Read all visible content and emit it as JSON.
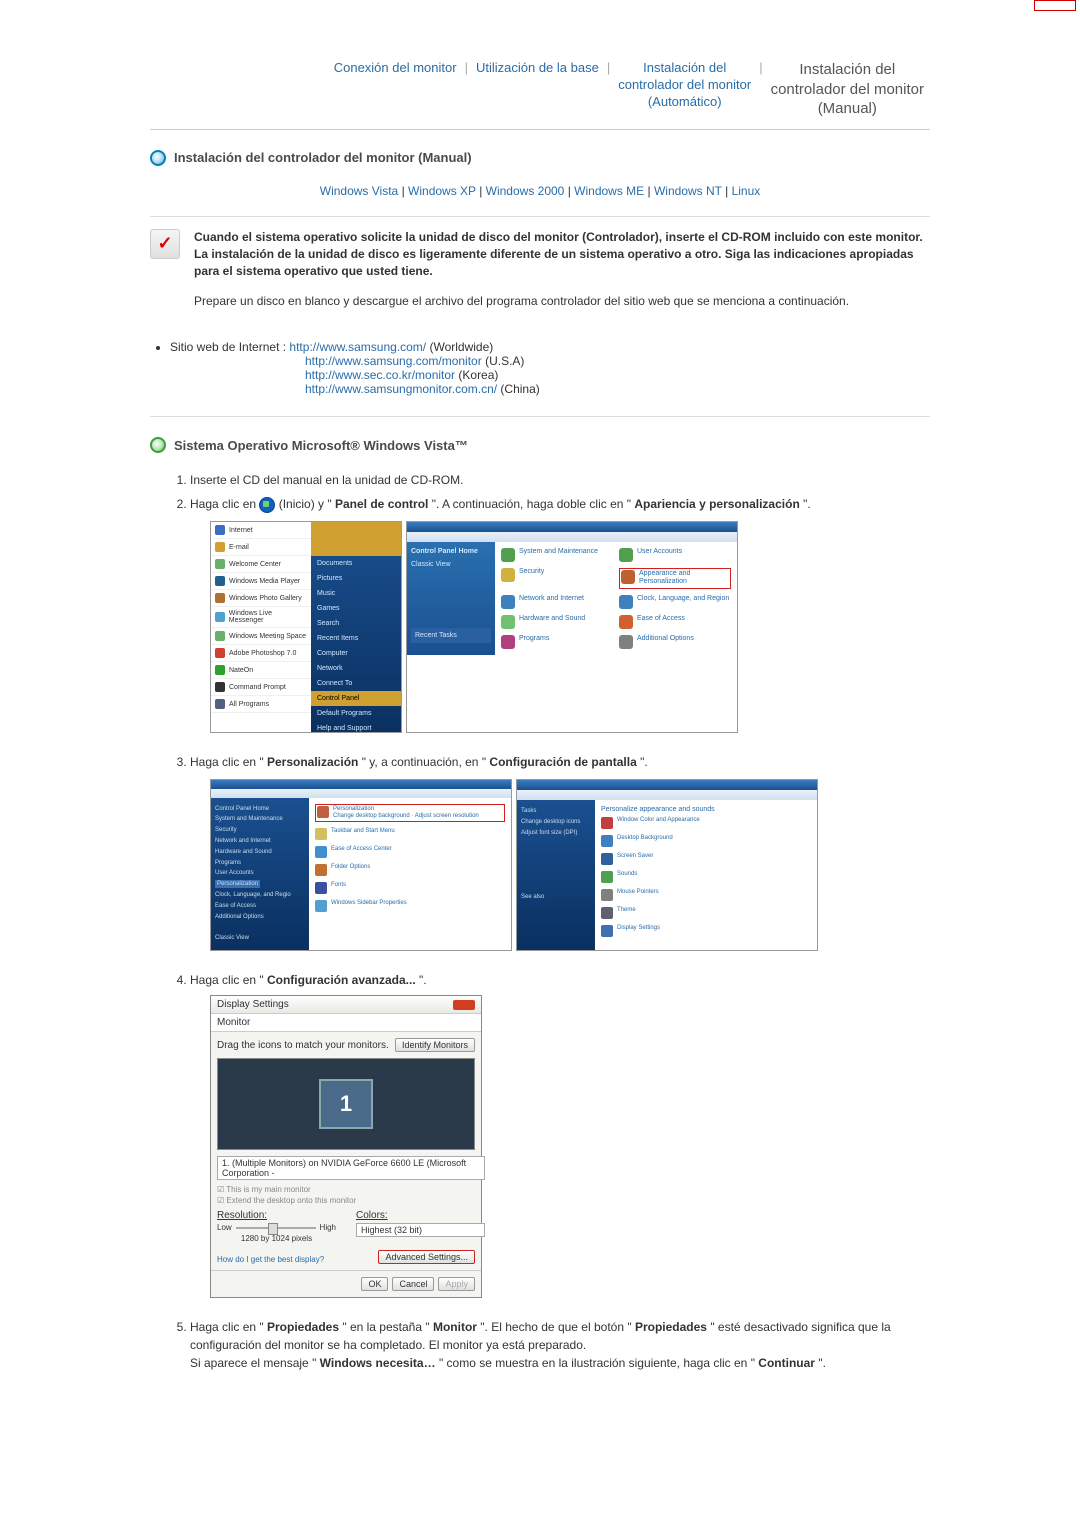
{
  "tabs": {
    "t1": "Conexión del monitor",
    "t2": "Utilización de la base",
    "t3": "Instalación del\ncontrolador del monitor\n(Automático)",
    "t4": "Instalación del\ncontrolador del monitor\n(Manual)"
  },
  "section1": {
    "title": "Instalación del controlador del monitor (Manual)"
  },
  "os_links": {
    "vista": "Windows Vista",
    "xp": "Windows XP",
    "w2000": "Windows 2000",
    "me": "Windows ME",
    "nt": "Windows NT",
    "linux": "Linux",
    "sep": " | "
  },
  "notice": {
    "text_bold": "Cuando el sistema operativo solicite la unidad de disco del monitor (Controlador), inserte el CD-ROM incluido con este monitor. La instalación de la unidad de disco es ligeramente diferente de un sistema operativo a otro. Siga las indicaciones apropiadas para el sistema operativo que usted tiene.",
    "para": "Prepare un disco en blanco y descargue el archivo del programa controlador del sitio web que se menciona a continuación."
  },
  "sites": {
    "lead": "Sitio web de Internet :",
    "url1": "http://www.samsung.com/",
    "suf1": " (Worldwide)",
    "url2": "http://www.samsung.com/monitor",
    "suf2": " (U.S.A)",
    "url3": "http://www.sec.co.kr/monitor",
    "suf3": " (Korea)",
    "url4": "http://www.samsungmonitor.com.cn/",
    "suf4": " (China)"
  },
  "section2": {
    "title": "Sistema Operativo Microsoft® Windows Vista™"
  },
  "steps": {
    "s1": "Inserte el CD del manual en la unidad de CD-ROM.",
    "s2a": "Haga clic en ",
    "s2b": "(Inicio) y \"",
    "s2c": "Panel de control",
    "s2d": "\". A continuación, haga doble clic en \"",
    "s2e": "Apariencia y personalización",
    "s2f": "\".",
    "s3a": "Haga clic en \"",
    "s3b": "Personalización",
    "s3c": "\" y, a continuación, en \"",
    "s3d": "Configuración de pantalla",
    "s3e": "\".",
    "s4a": "Haga clic en \"",
    "s4b": "Configuración avanzada...",
    "s4c": "\".",
    "s5a": "Haga clic en \"",
    "s5b": "Propiedades",
    "s5c": "\" en la pestaña \"",
    "s5d": "Monitor",
    "s5e": "\". El hecho de que el botón \"",
    "s5f": "Propiedades",
    "s5g": "\" esté desactivado significa que la configuración del monitor se ha completado. El monitor ya está preparado.",
    "s5h": "Si aparece el mensaje \"",
    "s5i": "Windows necesita…",
    "s5j": "\" como se muestra en la ilustración siguiente, haga clic en  \"",
    "s5k": "Continuar",
    "s5l": "\"."
  },
  "display_settings": {
    "title": "Display Settings",
    "tab": "Monitor",
    "drag": "Drag the icons to match your monitors.",
    "identify": "Identify Monitors",
    "mon_num": "1",
    "select": "1. (Multiple Monitors) on NVIDIA GeForce 6600 LE (Microsoft Corporation - ",
    "chk1": "This is my main monitor",
    "chk2": "Extend the desktop onto this monitor",
    "res_label": "Resolution:",
    "low": "Low",
    "high": "High",
    "res_val": "1280 by 1024 pixels",
    "colors_label": "Colors:",
    "colors_val": "Highest (32 bit)",
    "help": "How do I get the best display?",
    "adv": "Advanced Settings...",
    "ok": "OK",
    "cancel": "Cancel",
    "apply": "Apply"
  }
}
